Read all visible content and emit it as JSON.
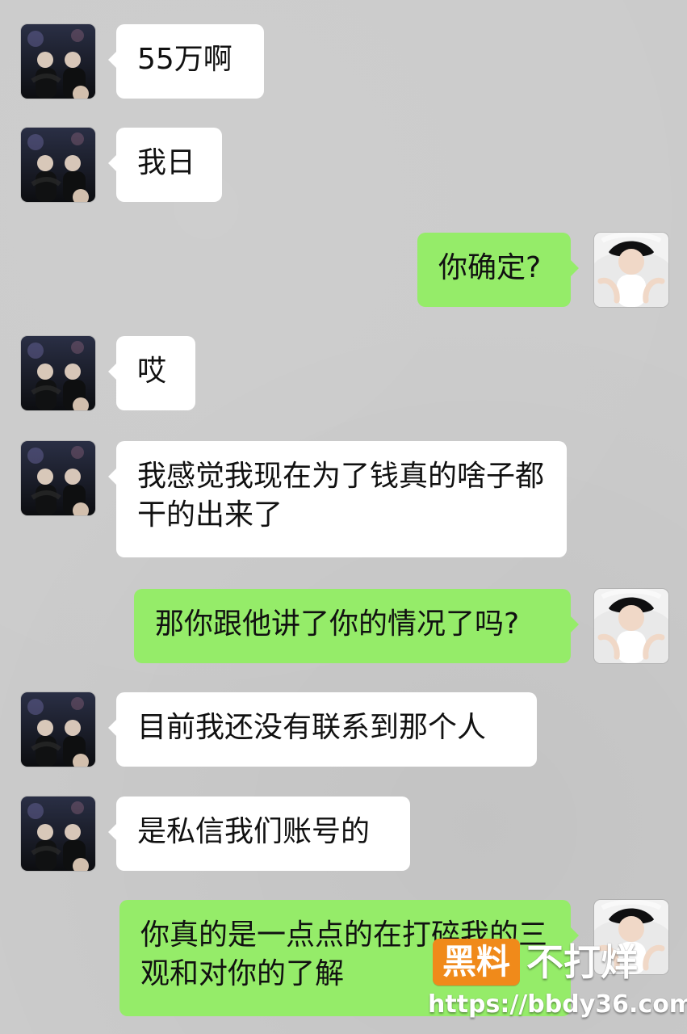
{
  "conversation": {
    "messages": [
      {
        "side": "left",
        "text": "55万啊"
      },
      {
        "side": "left",
        "text": "我日"
      },
      {
        "side": "right",
        "text": "你确定?"
      },
      {
        "side": "left",
        "text": "哎"
      },
      {
        "side": "left",
        "text": "我感觉我现在为了钱真的啥子都干的出来了"
      },
      {
        "side": "right",
        "text": "那你跟他讲了你的情况了吗?"
      },
      {
        "side": "left",
        "text": "目前我还没有联系到那个人"
      },
      {
        "side": "left",
        "text": "是私信我们账号的"
      },
      {
        "side": "right",
        "text": "你真的是一点点的在打碎我的三观和对你的了解"
      }
    ]
  },
  "watermark": {
    "badge": "黑料",
    "slogan": "不打烊",
    "url": "https://bbdy36.com"
  },
  "colors": {
    "background": "#cbcbcb",
    "incoming_bubble": "#ffffff",
    "outgoing_bubble": "#95ec69",
    "watermark_badge": "#f08a1a"
  }
}
